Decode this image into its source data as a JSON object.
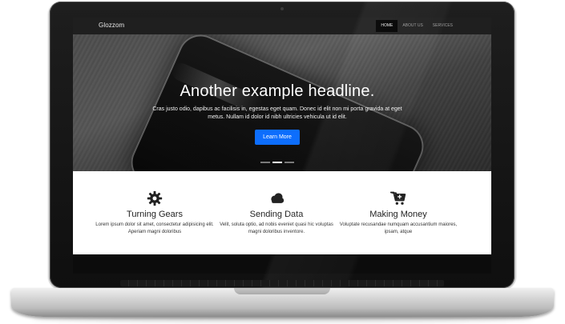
{
  "navbar": {
    "brand": "Glozzom",
    "items": [
      {
        "label": "HOME",
        "active": true
      },
      {
        "label": "ABOUT US",
        "active": false
      },
      {
        "label": "SERVICES",
        "active": false
      }
    ]
  },
  "hero": {
    "headline": "Another example headline.",
    "text": "Cras justo odio, dapibus ac facilisis in, egestas eget quam. Donec id elit non mi porta gravida at eget metus. Nullam id dolor id nibh ultricies vehicula ut id elit.",
    "button_label": "Learn More",
    "button_color": "#0d6efd",
    "slide_count": 3,
    "active_slide": 2
  },
  "features": [
    {
      "icon": "gear-icon",
      "title": "Turning Gears",
      "text": "Lorem ipsum dolor sit amet, consectetur adipisicing elit. Aperiam magni doloribus"
    },
    {
      "icon": "cloud-icon",
      "title": "Sending Data",
      "text": "Velit, soluta optio, ad nobis eveniet quasi hic voluptas magni doloribus inventore."
    },
    {
      "icon": "cart-plus-icon",
      "title": "Making Money",
      "text": "Voluptate recusandae numquam accusantium maiores, ipsam, atque"
    }
  ]
}
